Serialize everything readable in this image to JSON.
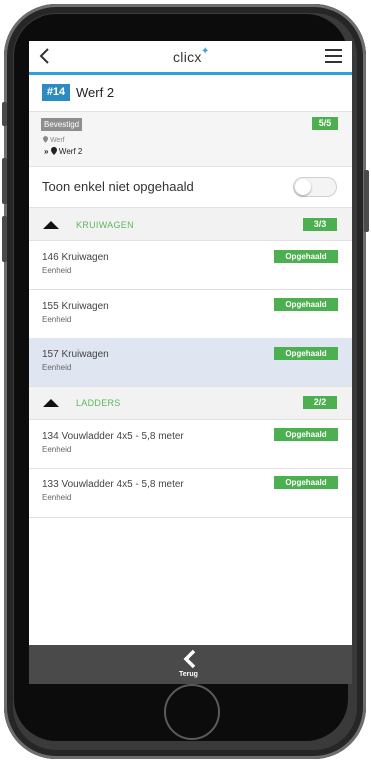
{
  "header": {
    "logo_text": "clicx",
    "logo_star": "✦"
  },
  "order": {
    "number": "#14",
    "title": "Werf 2"
  },
  "info": {
    "status": "Bevestigd",
    "count": "5/5",
    "location_from": "Werf",
    "location_to": "Werf 2"
  },
  "toggle": {
    "label": "Toon enkel niet opgehaald",
    "on": false
  },
  "groups": [
    {
      "name": "KRUIWAGEN",
      "count": "3/3",
      "items": [
        {
          "name": "146 Kruiwagen",
          "unit": "Eenheid",
          "status": "Opgehaald"
        },
        {
          "name": "155 Kruiwagen",
          "unit": "Eenheid",
          "status": "Opgehaald"
        },
        {
          "name": "157 Kruiwagen",
          "unit": "Eenheid",
          "status": "Opgehaald"
        }
      ]
    },
    {
      "name": "LADDERS",
      "count": "2/2",
      "items": [
        {
          "name": "134 Vouwladder 4x5 - 5,8 meter",
          "unit": "Eenheid",
          "status": "Opgehaald"
        },
        {
          "name": "133 Vouwladder 4x5 - 5,8 meter",
          "unit": "Eenheid",
          "status": "Opgehaald"
        }
      ]
    }
  ],
  "footer": {
    "back_label": "Terug"
  },
  "colors": {
    "accent": "#2ea3da",
    "success": "#4caf50",
    "footer": "#4a4a4a",
    "selected_row": "#dfe6f2"
  }
}
